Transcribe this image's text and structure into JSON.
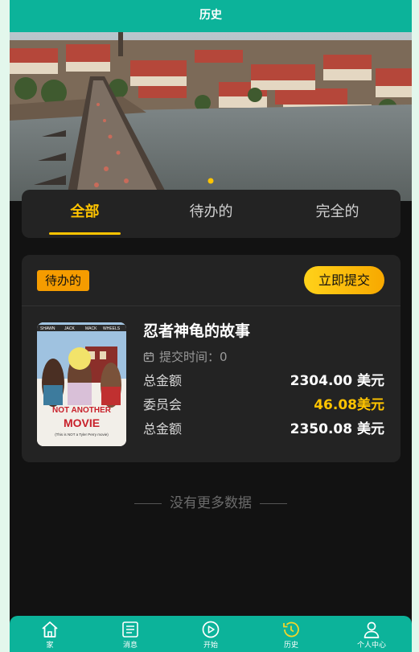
{
  "header": {
    "title": "历史"
  },
  "tabs": [
    {
      "label": "全部",
      "active": true
    },
    {
      "label": "待办的",
      "active": false
    },
    {
      "label": "完全的",
      "active": false
    }
  ],
  "order": {
    "status": "待办的",
    "action_label": "立即提交",
    "title": "忍者神龟的故事",
    "submit_time": "提交时间：0",
    "rows": [
      {
        "label": "总金额",
        "value": "2304.00 美元"
      },
      {
        "label": "委员会",
        "value": "46.08美元"
      },
      {
        "label": "总金额",
        "value": "2350.08 美元"
      }
    ],
    "poster": {
      "top_names": [
        "SHAWN",
        "JACK",
        "MACK",
        "WHEELS"
      ],
      "title_line1": "NOT ANOTHER",
      "title_line2": "MOVIE",
      "subtitle": "(This is NOT a Tyler Perry movie)"
    }
  },
  "no_more": "没有更多数据",
  "nav": [
    {
      "label": "家",
      "icon": "home-icon"
    },
    {
      "label": "消息",
      "icon": "message-icon"
    },
    {
      "label": "开始",
      "icon": "play-icon"
    },
    {
      "label": "历史",
      "icon": "history-icon"
    },
    {
      "label": "个人中心",
      "icon": "user-icon"
    }
  ],
  "colors": {
    "header": "#0cb39a",
    "accent": "#ffc400",
    "badge": "#f59c00"
  }
}
